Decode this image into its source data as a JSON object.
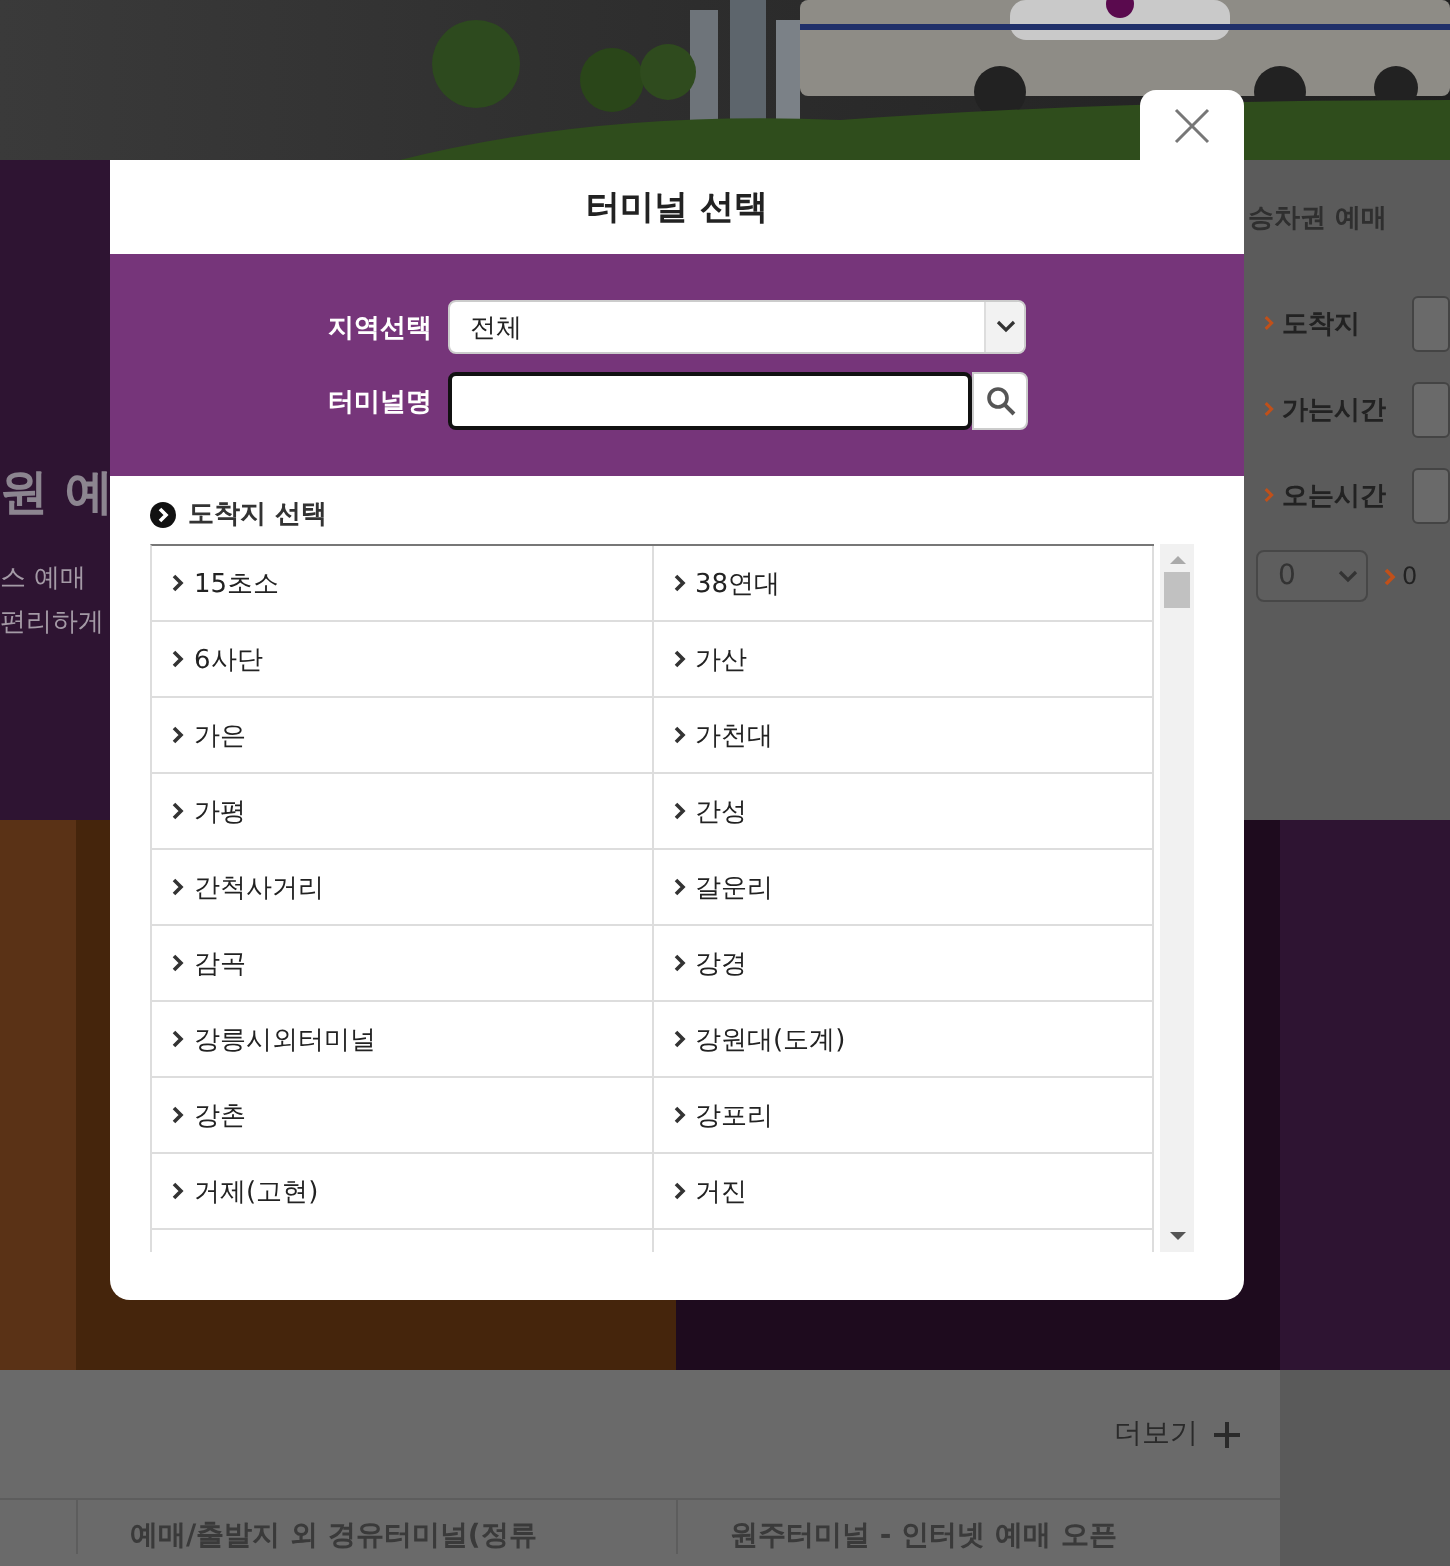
{
  "background": {
    "hero": {
      "headline": "원 예",
      "lines": [
        "스 예매",
        "편리하게"
      ]
    },
    "booking_panel": {
      "tab": "승차권 예매",
      "fields": [
        {
          "label": "도착지"
        },
        {
          "label": "가는시간"
        },
        {
          "label": "오는시간"
        }
      ],
      "count_select": {
        "value": "0"
      },
      "count_label": "0"
    },
    "notices": {
      "more": "더보기",
      "items": [
        "예매/출발지 외 경유터미널(정류",
        "원주터미널 - 인터넷 예매 오픈"
      ]
    }
  },
  "modal": {
    "title": "터미널 선택",
    "region": {
      "label": "지역선택",
      "value": "전체"
    },
    "terminal": {
      "label": "터미널명"
    },
    "list_title": "도착지 선택",
    "terminals": [
      "15초소",
      "38연대",
      "6사단",
      "가산",
      "가은",
      "가천대",
      "가평",
      "간성",
      "간척사거리",
      "갈운리",
      "감곡",
      "강경",
      "강릉시외터미널",
      "강원대(도계)",
      "강촌",
      "강포리",
      "거제(고현)",
      "거진"
    ]
  }
}
